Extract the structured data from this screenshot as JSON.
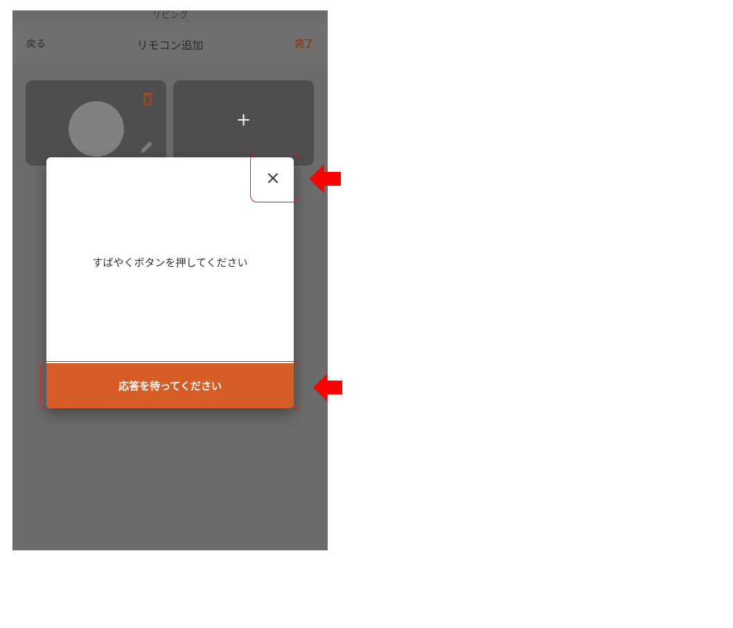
{
  "screen": {
    "peek_title": "リビング",
    "header": {
      "back_label": "戻る",
      "title": "リモコン追加",
      "done_label": "完了"
    },
    "cards": {
      "add_symbol": "+"
    }
  },
  "modal": {
    "close_symbol": "×",
    "message": "すばやくボタンを押してください",
    "action_label": "応答を待ってください"
  },
  "colors": {
    "accent": "#d75d26",
    "overlay": "#6b6b6b",
    "highlight": "#e31c1c"
  }
}
